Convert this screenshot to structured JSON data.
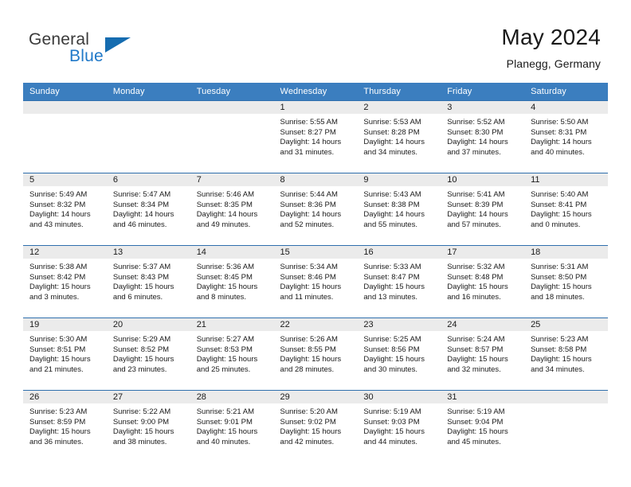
{
  "brand": {
    "name_part1": "General",
    "name_part2": "Blue",
    "triangle_color": "#156cb0",
    "blue_color": "#1f78c8"
  },
  "header": {
    "title": "May 2024",
    "subtitle": "Planegg, Germany"
  },
  "theme": {
    "header_bg": "#3b7ebf",
    "daynum_bg": "#ebebeb",
    "row_rule": "#2f6fad",
    "text": "#1a1a1a"
  },
  "weekday_headers": [
    "Sunday",
    "Monday",
    "Tuesday",
    "Wednesday",
    "Thursday",
    "Friday",
    "Saturday"
  ],
  "weeks": [
    [
      {
        "day": "",
        "lines": []
      },
      {
        "day": "",
        "lines": []
      },
      {
        "day": "",
        "lines": []
      },
      {
        "day": "1",
        "lines": [
          "Sunrise: 5:55 AM",
          "Sunset: 8:27 PM",
          "Daylight: 14 hours",
          "and 31 minutes."
        ]
      },
      {
        "day": "2",
        "lines": [
          "Sunrise: 5:53 AM",
          "Sunset: 8:28 PM",
          "Daylight: 14 hours",
          "and 34 minutes."
        ]
      },
      {
        "day": "3",
        "lines": [
          "Sunrise: 5:52 AM",
          "Sunset: 8:30 PM",
          "Daylight: 14 hours",
          "and 37 minutes."
        ]
      },
      {
        "day": "4",
        "lines": [
          "Sunrise: 5:50 AM",
          "Sunset: 8:31 PM",
          "Daylight: 14 hours",
          "and 40 minutes."
        ]
      }
    ],
    [
      {
        "day": "5",
        "lines": [
          "Sunrise: 5:49 AM",
          "Sunset: 8:32 PM",
          "Daylight: 14 hours",
          "and 43 minutes."
        ]
      },
      {
        "day": "6",
        "lines": [
          "Sunrise: 5:47 AM",
          "Sunset: 8:34 PM",
          "Daylight: 14 hours",
          "and 46 minutes."
        ]
      },
      {
        "day": "7",
        "lines": [
          "Sunrise: 5:46 AM",
          "Sunset: 8:35 PM",
          "Daylight: 14 hours",
          "and 49 minutes."
        ]
      },
      {
        "day": "8",
        "lines": [
          "Sunrise: 5:44 AM",
          "Sunset: 8:36 PM",
          "Daylight: 14 hours",
          "and 52 minutes."
        ]
      },
      {
        "day": "9",
        "lines": [
          "Sunrise: 5:43 AM",
          "Sunset: 8:38 PM",
          "Daylight: 14 hours",
          "and 55 minutes."
        ]
      },
      {
        "day": "10",
        "lines": [
          "Sunrise: 5:41 AM",
          "Sunset: 8:39 PM",
          "Daylight: 14 hours",
          "and 57 minutes."
        ]
      },
      {
        "day": "11",
        "lines": [
          "Sunrise: 5:40 AM",
          "Sunset: 8:41 PM",
          "Daylight: 15 hours",
          "and 0 minutes."
        ]
      }
    ],
    [
      {
        "day": "12",
        "lines": [
          "Sunrise: 5:38 AM",
          "Sunset: 8:42 PM",
          "Daylight: 15 hours",
          "and 3 minutes."
        ]
      },
      {
        "day": "13",
        "lines": [
          "Sunrise: 5:37 AM",
          "Sunset: 8:43 PM",
          "Daylight: 15 hours",
          "and 6 minutes."
        ]
      },
      {
        "day": "14",
        "lines": [
          "Sunrise: 5:36 AM",
          "Sunset: 8:45 PM",
          "Daylight: 15 hours",
          "and 8 minutes."
        ]
      },
      {
        "day": "15",
        "lines": [
          "Sunrise: 5:34 AM",
          "Sunset: 8:46 PM",
          "Daylight: 15 hours",
          "and 11 minutes."
        ]
      },
      {
        "day": "16",
        "lines": [
          "Sunrise: 5:33 AM",
          "Sunset: 8:47 PM",
          "Daylight: 15 hours",
          "and 13 minutes."
        ]
      },
      {
        "day": "17",
        "lines": [
          "Sunrise: 5:32 AM",
          "Sunset: 8:48 PM",
          "Daylight: 15 hours",
          "and 16 minutes."
        ]
      },
      {
        "day": "18",
        "lines": [
          "Sunrise: 5:31 AM",
          "Sunset: 8:50 PM",
          "Daylight: 15 hours",
          "and 18 minutes."
        ]
      }
    ],
    [
      {
        "day": "19",
        "lines": [
          "Sunrise: 5:30 AM",
          "Sunset: 8:51 PM",
          "Daylight: 15 hours",
          "and 21 minutes."
        ]
      },
      {
        "day": "20",
        "lines": [
          "Sunrise: 5:29 AM",
          "Sunset: 8:52 PM",
          "Daylight: 15 hours",
          "and 23 minutes."
        ]
      },
      {
        "day": "21",
        "lines": [
          "Sunrise: 5:27 AM",
          "Sunset: 8:53 PM",
          "Daylight: 15 hours",
          "and 25 minutes."
        ]
      },
      {
        "day": "22",
        "lines": [
          "Sunrise: 5:26 AM",
          "Sunset: 8:55 PM",
          "Daylight: 15 hours",
          "and 28 minutes."
        ]
      },
      {
        "day": "23",
        "lines": [
          "Sunrise: 5:25 AM",
          "Sunset: 8:56 PM",
          "Daylight: 15 hours",
          "and 30 minutes."
        ]
      },
      {
        "day": "24",
        "lines": [
          "Sunrise: 5:24 AM",
          "Sunset: 8:57 PM",
          "Daylight: 15 hours",
          "and 32 minutes."
        ]
      },
      {
        "day": "25",
        "lines": [
          "Sunrise: 5:23 AM",
          "Sunset: 8:58 PM",
          "Daylight: 15 hours",
          "and 34 minutes."
        ]
      }
    ],
    [
      {
        "day": "26",
        "lines": [
          "Sunrise: 5:23 AM",
          "Sunset: 8:59 PM",
          "Daylight: 15 hours",
          "and 36 minutes."
        ]
      },
      {
        "day": "27",
        "lines": [
          "Sunrise: 5:22 AM",
          "Sunset: 9:00 PM",
          "Daylight: 15 hours",
          "and 38 minutes."
        ]
      },
      {
        "day": "28",
        "lines": [
          "Sunrise: 5:21 AM",
          "Sunset: 9:01 PM",
          "Daylight: 15 hours",
          "and 40 minutes."
        ]
      },
      {
        "day": "29",
        "lines": [
          "Sunrise: 5:20 AM",
          "Sunset: 9:02 PM",
          "Daylight: 15 hours",
          "and 42 minutes."
        ]
      },
      {
        "day": "30",
        "lines": [
          "Sunrise: 5:19 AM",
          "Sunset: 9:03 PM",
          "Daylight: 15 hours",
          "and 44 minutes."
        ]
      },
      {
        "day": "31",
        "lines": [
          "Sunrise: 5:19 AM",
          "Sunset: 9:04 PM",
          "Daylight: 15 hours",
          "and 45 minutes."
        ]
      },
      {
        "day": "",
        "lines": []
      }
    ]
  ]
}
